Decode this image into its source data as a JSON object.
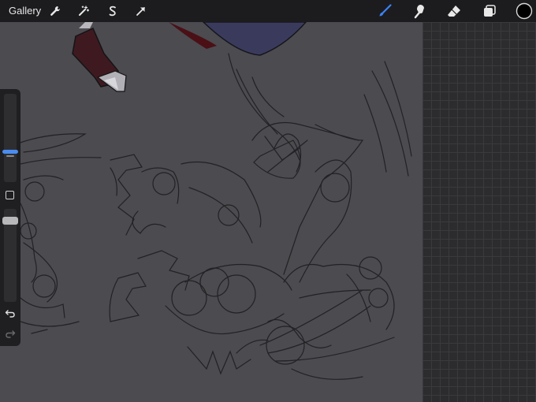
{
  "app": {
    "gallery_label": "Gallery"
  },
  "toolbar": {
    "left_tools": [
      "wrench-icon",
      "magic-wand-icon",
      "selection-s-icon",
      "transform-arrow-icon"
    ],
    "right_tools": [
      "brush-icon",
      "smudge-icon",
      "eraser-icon",
      "layers-icon",
      "color-swatch"
    ],
    "active_tool": "brush-icon",
    "accent_color": "#3b82f6",
    "current_color": "#000000"
  },
  "sidebar": {
    "brush_size_level": 0.6,
    "opacity_level": 0.4
  },
  "colors": {
    "toolbar_bg": "#1c1c1e",
    "canvas_bg": "#4b4b50",
    "grid_bg": "#2c2c2e",
    "sketch_stroke": "#1e1e20"
  }
}
